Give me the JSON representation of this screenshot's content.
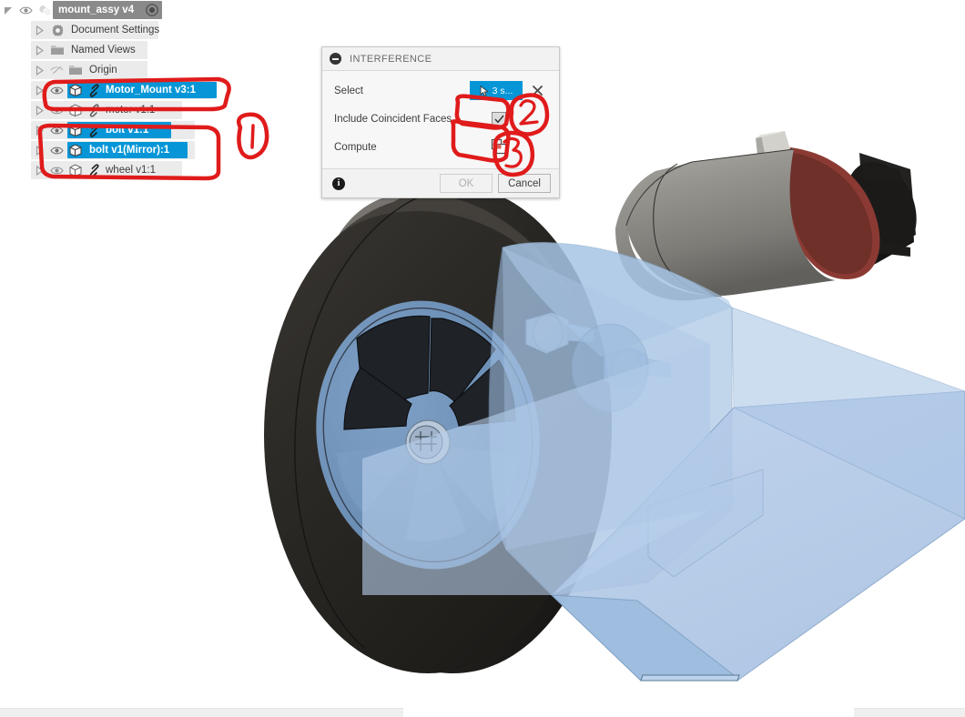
{
  "app": {
    "canvas_background": "#ffffff",
    "accent_color": "#0696d7",
    "annotation_color": "#e01b1b"
  },
  "browser_tree": {
    "root": {
      "label": "mount_assy v4",
      "expand_icon": "triangle-down-icon",
      "visibility_icon": "eye-icon",
      "document_icon": "assembly-icon",
      "activate_icon": "radio-dot-icon"
    },
    "items": [
      {
        "label": "Document Settings",
        "icon": "gear-icon",
        "expand_icon": "triangle-right-icon",
        "has_eye": false,
        "eye_hidden": false,
        "has_link": false,
        "has_component_icon": false,
        "selected": false,
        "indent": 46
      },
      {
        "label": "Named Views",
        "icon": "folder-icon",
        "expand_icon": "triangle-right-icon",
        "has_eye": false,
        "eye_hidden": false,
        "has_link": false,
        "has_component_icon": false,
        "selected": false,
        "indent": 46
      },
      {
        "label": "Origin",
        "icon": "folder-icon",
        "expand_icon": "triangle-right-icon",
        "has_eye": true,
        "eye_hidden": true,
        "has_link": false,
        "has_component_icon": false,
        "selected": false,
        "indent": 46
      },
      {
        "label": "Motor_Mount v3:1",
        "icon": "component-icon",
        "expand_icon": "triangle-right-icon",
        "has_eye": true,
        "eye_hidden": false,
        "has_link": true,
        "has_component_icon": true,
        "selected": true,
        "indent": 46
      },
      {
        "label": "motor v1:1",
        "icon": "component-icon",
        "expand_icon": "triangle-right-icon",
        "has_eye": true,
        "eye_hidden": false,
        "has_link": true,
        "has_component_icon": true,
        "selected": false,
        "indent": 46
      },
      {
        "label": "bolt v1:1",
        "icon": "component-icon",
        "expand_icon": "triangle-right-icon",
        "has_eye": true,
        "eye_hidden": false,
        "has_link": true,
        "has_component_icon": true,
        "selected": true,
        "indent": 46
      },
      {
        "label": "bolt v1(Mirror):1",
        "icon": "component-icon",
        "expand_icon": "triangle-right-icon",
        "has_eye": true,
        "eye_hidden": false,
        "has_link": false,
        "has_component_icon": true,
        "selected": true,
        "indent": 46
      },
      {
        "label": "wheel v1:1",
        "icon": "component-icon",
        "expand_icon": "triangle-right-icon",
        "has_eye": true,
        "eye_hidden": false,
        "has_link": true,
        "has_component_icon": true,
        "selected": false,
        "indent": 46
      }
    ]
  },
  "dialog": {
    "title": "INTERFERENCE",
    "collapse_icon": "minus-circle-icon",
    "fields": {
      "select": {
        "label": "Select",
        "button_value": "3 s...",
        "button_icon": "cursor-arrow-icon",
        "clear_icon": "x-icon"
      },
      "include_coincident_faces": {
        "label": "Include Coincident Faces",
        "checked": true,
        "checkbox_icon": "checkbox-checked-icon"
      },
      "compute": {
        "label": "Compute",
        "button_icon": "compute-overlap-icon"
      }
    },
    "footer": {
      "info_icon": "info-icon",
      "ok_label": "OK",
      "ok_enabled": false,
      "cancel_label": "Cancel"
    }
  },
  "annotations": [
    {
      "name": "callout-1",
      "text": "1",
      "shape": "circle",
      "target": "bolt rows in browser tree"
    },
    {
      "name": "callout-2",
      "text": "2",
      "shape": "circle",
      "target": "Include Coincident Faces checkbox"
    },
    {
      "name": "callout-3",
      "text": "3",
      "shape": "circle",
      "target": "Compute button"
    },
    {
      "name": "highlight-box-motor-mount",
      "shape": "rounded-rect",
      "target": "Motor_Mount v3:1 row"
    },
    {
      "name": "highlight-box-bolts",
      "shape": "rounded-rect",
      "target": "bolt v1:1 and bolt v1(Mirror):1 rows"
    },
    {
      "name": "highlight-box-coincident",
      "shape": "rounded-rect",
      "target": "Include Coincident Faces checkbox"
    },
    {
      "name": "highlight-box-compute",
      "shape": "rounded-rect",
      "target": "Compute button"
    }
  ],
  "viewport": {
    "model_name": "mount_assy",
    "parts": [
      {
        "name": "wheel-tire",
        "color": "#2b2926"
      },
      {
        "name": "wheel-rim",
        "color": "#6f92b8"
      },
      {
        "name": "motor-body",
        "color": "#888781"
      },
      {
        "name": "motor-endcap",
        "color": "#8a3b34"
      },
      {
        "name": "motor-mount-plate",
        "color": "#a8c3e4"
      },
      {
        "name": "bolt",
        "color": "#b6cce8"
      }
    ]
  }
}
